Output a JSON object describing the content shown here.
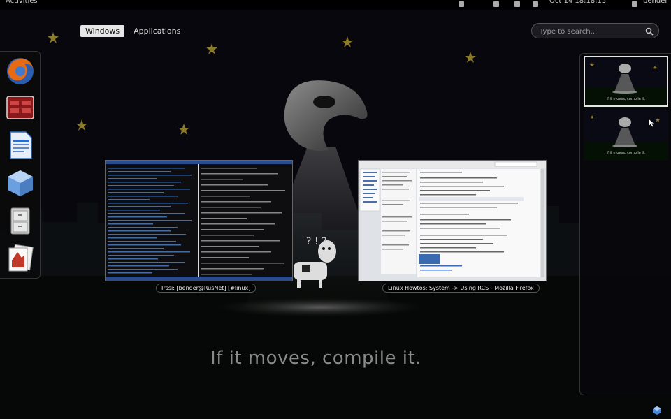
{
  "topbar": {
    "activities_label": "Activities",
    "clock": "Oct 14 18:18:15",
    "user": "bender"
  },
  "overview": {
    "tabs": [
      {
        "label": "Windows",
        "active": true
      },
      {
        "label": "Applications",
        "active": false
      }
    ],
    "search": {
      "placeholder": "Type to search..."
    }
  },
  "dash": {
    "items": [
      {
        "app": "Firefox",
        "icon": "firefox-icon"
      },
      {
        "app": "Terminal",
        "icon": "terminal-icon"
      },
      {
        "app": "Writer",
        "icon": "writer-icon"
      },
      {
        "app": "3D Box",
        "icon": "box-icon"
      },
      {
        "app": "File Cabinet",
        "icon": "file-cabinet-icon"
      },
      {
        "app": "Documents",
        "icon": "documents-icon"
      }
    ]
  },
  "windows": [
    {
      "title": "Irssi: [bender@RusNet] [#linux]",
      "type": "terminal"
    },
    {
      "title": "Linux Howtos: System -> Using RCS - Mozilla Firefox",
      "type": "browser"
    }
  ],
  "wallpaper": {
    "tagline": "If it moves, compile it."
  },
  "workspaces": [
    {
      "caption": "If it moves, compile it.",
      "active": true
    },
    {
      "caption": "If it moves, compile it.",
      "active": false
    }
  ],
  "colors": {
    "background": "#07070d",
    "star": "#8a7a2a",
    "tab_active": "#e6e6e6",
    "tagline": "#8a8a8a"
  }
}
